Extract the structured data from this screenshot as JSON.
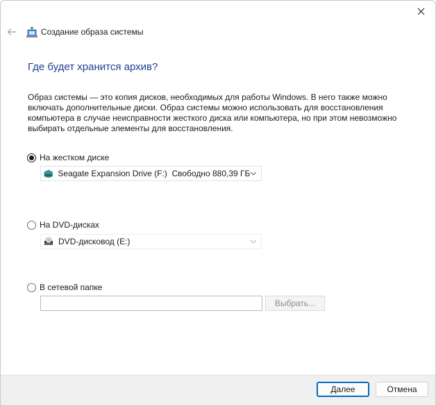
{
  "window": {
    "title": "Создание образа системы",
    "accent_color": "#1e3f8f"
  },
  "content": {
    "heading": "Где будет хранится архив?",
    "description": "Образ системы — это копия дисков, необходимых для работы Windows. В него также можно включать дополнительные диски. Образ системы можно использовать для восстановления компьютера в случае неисправности жесткого диска или компьютера, но при этом невозможно выбирать отдельные элементы для восстановления."
  },
  "options": {
    "hard_disk": {
      "label": "На жестком диске",
      "selected": true,
      "drive_value": "Seagate Expansion Drive (F:)  Свободно 880,39 ГБ",
      "drive_icon": "external-drive-icon"
    },
    "dvd": {
      "label": "На DVD-дисках",
      "selected": false,
      "drive_value": "DVD-дисковод (E:)",
      "drive_icon": "dvd-drive-icon"
    },
    "network": {
      "label": "В сетевой папке",
      "selected": false,
      "path_value": "",
      "browse_label": "Выбрать..."
    }
  },
  "footer": {
    "next_label": "Далее",
    "cancel_label": "Отмена"
  }
}
